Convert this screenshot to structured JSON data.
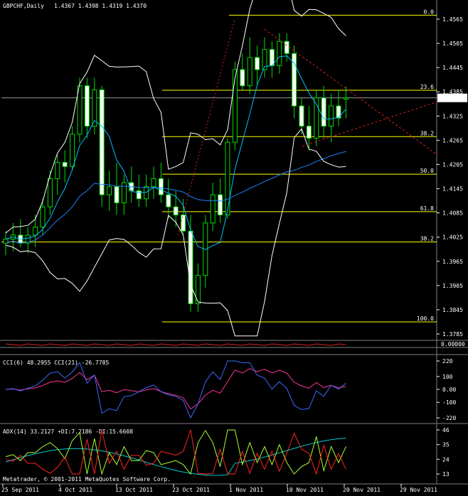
{
  "header": {
    "symbol": "GBPCHF,Daily",
    "ohlc": "1.4367 1.4398 1.4319 1.4370"
  },
  "price_axis": {
    "ticks": [
      "1.4565",
      "1.4505",
      "1.4445",
      "1.4385",
      "1.4325",
      "1.4265",
      "1.4205",
      "1.4145",
      "1.4085",
      "1.4025",
      "1.3965",
      "1.3905",
      "1.3845",
      "1.3785"
    ],
    "current_price": "1.4370"
  },
  "fibo": {
    "upper": [
      {
        "label": "0.0",
        "price": 1.4575
      },
      {
        "label": "23.6",
        "price": 1.4389
      },
      {
        "label": "38.2",
        "price": 1.4274
      },
      {
        "label": "50.0",
        "price": 1.4181
      },
      {
        "label": "61.8",
        "price": 1.4088
      }
    ],
    "lower_level": {
      "label": "38.2",
      "price": 1.4013
    },
    "bottom_level": {
      "label": "100.0",
      "price": 1.3815
    }
  },
  "subwindow1": {
    "label": "0.00000"
  },
  "cci": {
    "title": "CCI(6) 48.2955   CCI(21) -26.7785",
    "ticks": [
      "220",
      "100",
      "0.00",
      "-100",
      "-220"
    ]
  },
  "adx": {
    "title": "ADX(14) 33.2127 +DI:7.2186 -DI:15.6608",
    "ticks": [
      "46",
      "35",
      "24",
      "13"
    ]
  },
  "copyright": "Metatrader, © 2001-2011 MetaQuotes Software Corp.",
  "time_axis": [
    "25 Sep 2011",
    "4 Oct 2011",
    "13 Oct 2011",
    "23 Oct 2011",
    "1 Nov 2011",
    "10 Nov 2011",
    "20 Nov 2011",
    "29 Nov 2011"
  ],
  "colors": {
    "candle": "#00dd00",
    "bollinger": "#ffffff",
    "ma_fast": "#00bfff",
    "ma_slow": "#1e7fff",
    "fibo": "#ffff00",
    "trend": "#dd2222",
    "cci6": "#3a6bff",
    "cci21": "#ff3399",
    "adx": "#00cccc",
    "plus_di": "#aaff33",
    "minus_di": "#ff2222"
  },
  "chart_data": {
    "type": "candlestick",
    "title": "GBPCHF,Daily",
    "ylim": [
      1.377,
      1.46
    ],
    "candles": [
      [
        1.401,
        1.404,
        1.398,
        1.402
      ],
      [
        1.402,
        1.406,
        1.399,
        1.403
      ],
      [
        1.403,
        1.407,
        1.4,
        1.401
      ],
      [
        1.401,
        1.405,
        1.3985,
        1.403
      ],
      [
        1.403,
        1.408,
        1.4,
        1.405
      ],
      [
        1.405,
        1.412,
        1.403,
        1.41
      ],
      [
        1.41,
        1.419,
        1.408,
        1.417
      ],
      [
        1.417,
        1.423,
        1.413,
        1.421
      ],
      [
        1.421,
        1.424,
        1.416,
        1.42
      ],
      [
        1.42,
        1.43,
        1.419,
        1.428
      ],
      [
        1.428,
        1.442,
        1.426,
        1.44
      ],
      [
        1.44,
        1.442,
        1.427,
        1.43
      ],
      [
        1.43,
        1.442,
        1.428,
        1.439
      ],
      [
        1.439,
        1.44,
        1.41,
        1.413
      ],
      [
        1.413,
        1.419,
        1.409,
        1.415
      ],
      [
        1.415,
        1.421,
        1.408,
        1.411
      ],
      [
        1.411,
        1.418,
        1.408,
        1.416
      ],
      [
        1.416,
        1.42,
        1.411,
        1.414
      ],
      [
        1.414,
        1.418,
        1.41,
        1.412
      ],
      [
        1.412,
        1.418,
        1.41,
        1.415
      ],
      [
        1.415,
        1.42,
        1.412,
        1.417
      ],
      [
        1.417,
        1.421,
        1.411,
        1.413
      ],
      [
        1.413,
        1.417,
        1.407,
        1.41
      ],
      [
        1.41,
        1.414,
        1.405,
        1.408
      ],
      [
        1.408,
        1.412,
        1.403,
        1.404
      ],
      [
        1.404,
        1.408,
        1.384,
        1.386
      ],
      [
        1.386,
        1.396,
        1.384,
        1.393
      ],
      [
        1.393,
        1.408,
        1.39,
        1.406
      ],
      [
        1.406,
        1.416,
        1.404,
        1.413
      ],
      [
        1.413,
        1.417,
        1.406,
        1.408
      ],
      [
        1.408,
        1.427,
        1.407,
        1.426
      ],
      [
        1.426,
        1.446,
        1.424,
        1.444
      ],
      [
        1.444,
        1.448,
        1.439,
        1.44
      ],
      [
        1.44,
        1.452,
        1.438,
        1.447
      ],
      [
        1.447,
        1.45,
        1.44,
        1.444
      ],
      [
        1.444,
        1.452,
        1.442,
        1.449
      ],
      [
        1.449,
        1.451,
        1.442,
        1.445
      ],
      [
        1.445,
        1.453,
        1.443,
        1.451
      ],
      [
        1.451,
        1.453,
        1.446,
        1.448
      ],
      [
        1.448,
        1.45,
        1.432,
        1.435
      ],
      [
        1.435,
        1.437,
        1.428,
        1.43
      ],
      [
        1.43,
        1.435,
        1.424,
        1.427
      ],
      [
        1.427,
        1.439,
        1.425,
        1.437
      ],
      [
        1.437,
        1.44,
        1.427,
        1.43
      ],
      [
        1.43,
        1.438,
        1.426,
        1.435
      ],
      [
        1.435,
        1.439,
        1.43,
        1.432
      ],
      [
        1.4367,
        1.4398,
        1.4319,
        1.437
      ]
    ]
  }
}
